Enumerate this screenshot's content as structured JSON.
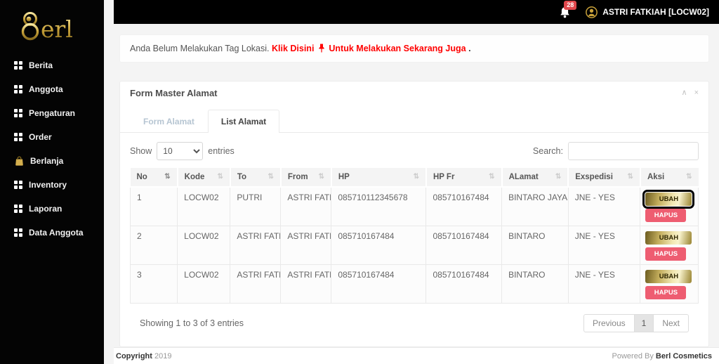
{
  "brand": {
    "logo_text": "erl"
  },
  "topbar": {
    "notification_count": "28",
    "user_name": "ASTRI FATKIAH [LOCW02]"
  },
  "sidebar": {
    "items": [
      {
        "label": "Berita",
        "icon": "grid-icon"
      },
      {
        "label": "Anggota",
        "icon": "grid-icon"
      },
      {
        "label": "Pengaturan",
        "icon": "grid-icon"
      },
      {
        "label": "Order",
        "icon": "grid-icon"
      },
      {
        "label": "Berlanja",
        "icon": "bag-icon"
      },
      {
        "label": "Inventory",
        "icon": "grid-icon"
      },
      {
        "label": "Laporan",
        "icon": "grid-icon"
      },
      {
        "label": "Data Anggota",
        "icon": "grid-icon"
      }
    ]
  },
  "alert": {
    "text": "Anda Belum Melakukan Tag Lokasi.",
    "link_text": "Klik Disini",
    "after_icon_text": "Untuk Melakukan Sekarang Juga",
    "trailing": "."
  },
  "panel": {
    "title": "Form Master Alamat",
    "tabs": [
      {
        "label": "Form Alamat",
        "active": false
      },
      {
        "label": "List Alamat",
        "active": true
      }
    ],
    "tools": {
      "collapse": "∧",
      "close": "×"
    }
  },
  "table": {
    "show_label": "Show",
    "page_length": "10",
    "entries_label": "entries",
    "search_label": "Search:",
    "columns": [
      {
        "label": "No",
        "sorted": true
      },
      {
        "label": "Kode"
      },
      {
        "label": "To"
      },
      {
        "label": "From"
      },
      {
        "label": "HP"
      },
      {
        "label": "HP Fr"
      },
      {
        "label": "ALamat"
      },
      {
        "label": "Exspedisi"
      },
      {
        "label": "Aksi"
      }
    ],
    "rows": [
      {
        "no": "1",
        "kode": "LOCW02",
        "to": "PUTRI",
        "from": "ASTRI FATKIAH",
        "hp": "085710112345678",
        "hp_fr": "085710167484",
        "alamat": "BINTARO JAYA",
        "exspedisi": "JNE - YES",
        "ubah_highlighted": true
      },
      {
        "no": "2",
        "kode": "LOCW02",
        "to": "ASTRI FATKIAH",
        "from": "ASTRI FATKIAH",
        "hp": "085710167484",
        "hp_fr": "085710167484",
        "alamat": "BINTARO",
        "exspedisi": "JNE - YES"
      },
      {
        "no": "3",
        "kode": "LOCW02",
        "to": "ASTRI FATKIAH",
        "from": "ASTRI FATKIAH",
        "hp": "085710167484",
        "hp_fr": "085710167484",
        "alamat": "BINTARO",
        "exspedisi": "JNE - YES"
      }
    ],
    "actions": {
      "ubah": "UBAH",
      "hapus": "HAPUS"
    },
    "info": "Showing 1 to 3 of 3 entries",
    "pagination": {
      "previous": "Previous",
      "page": "1",
      "next": "Next"
    }
  },
  "footer": {
    "copyright_label": "Copyright",
    "year": "2019",
    "powered_prefix": "Powered By",
    "powered_brand": "Berl Cosmetics"
  },
  "colors": {
    "sidebar_bg": "#040404",
    "gold_dark": "#6a5a1e",
    "gold_light": "#f8f2cc",
    "hapus_red": "#ee5d71",
    "badge_red": "#e0474c",
    "alert_red": "#ff0000"
  }
}
